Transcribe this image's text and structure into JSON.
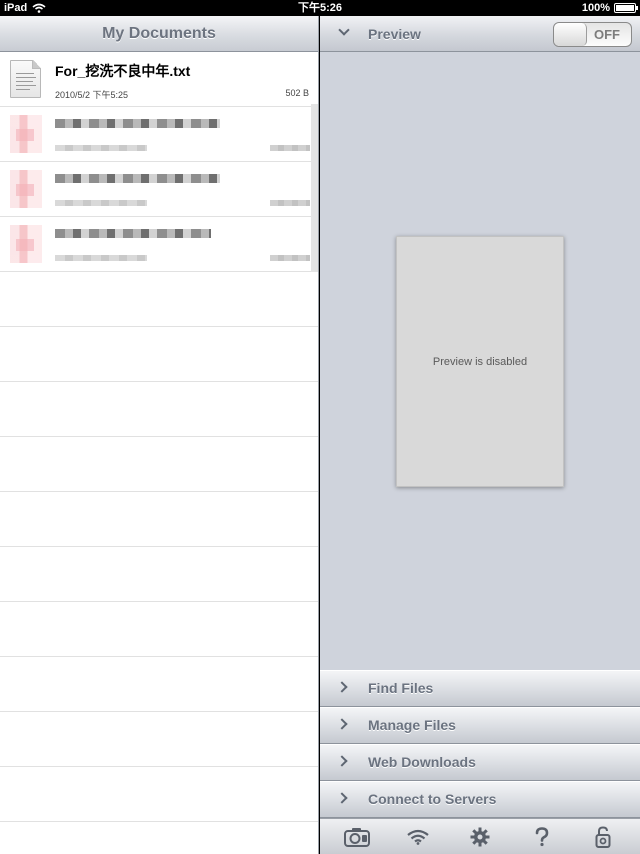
{
  "status_bar": {
    "device": "iPad",
    "time": "下午5:26",
    "battery": "100%",
    "battery_level": 1.0
  },
  "left_pane": {
    "title": "My Documents",
    "documents": [
      {
        "name": "For_挖洗不良中年.txt",
        "date": "2010/5/2 下午5:25",
        "size": "502 B"
      }
    ]
  },
  "right_pane": {
    "preview_title": "Preview",
    "preview_toggle": "OFF",
    "preview_message": "Preview is disabled",
    "menu": [
      "Find Files",
      "Manage Files",
      "Web Downloads",
      "Connect to Servers"
    ],
    "toolbar_icons": [
      "camera-icon",
      "wifi-icon",
      "gear-icon",
      "help-icon",
      "lock-icon"
    ]
  }
}
